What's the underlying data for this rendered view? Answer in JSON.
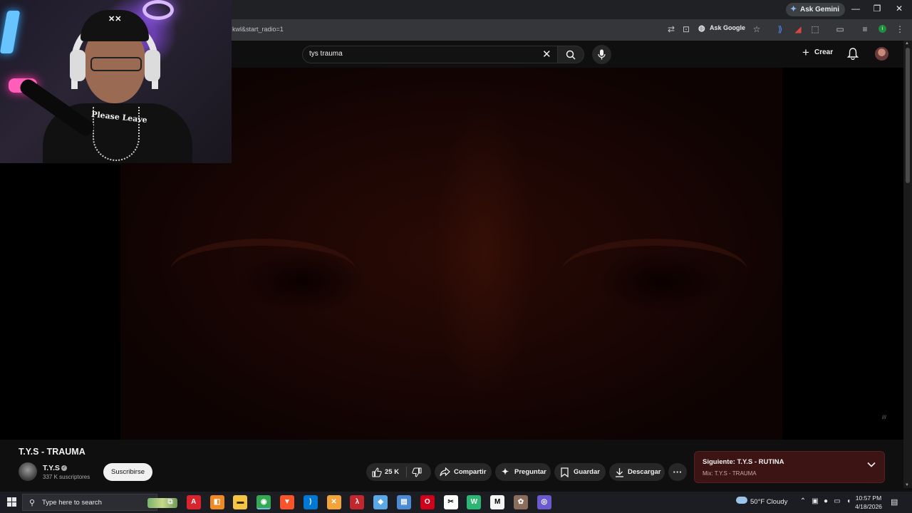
{
  "browser": {
    "gemini_label": "Ask Gemini",
    "url_fragment": "kwl&start_radio=1",
    "ask_google_label": "Ask Google",
    "profile_initial": "i",
    "window": {
      "minimize": "—",
      "restore": "❐",
      "close": "✕"
    }
  },
  "youtube": {
    "search": {
      "value": "tys trauma"
    },
    "create_label": "Crear"
  },
  "video": {
    "title": "T.Y.S - TRAUMA",
    "watermark": "///",
    "channel": {
      "name": "T.Y.S",
      "subscribers": "337 K suscriptores",
      "subscribe_label": "Suscribirse"
    },
    "actions": {
      "likes": "25 K",
      "share": "Compartir",
      "ask": "Preguntar",
      "save": "Guardar",
      "download": "Descargar",
      "more": "···"
    },
    "up_next": {
      "label": "Siguiente: T.Y.S - RUTINA",
      "mix": "Mix: T.Y.S - TRAUMA"
    }
  },
  "webcam": {
    "shirt_text": "Please Leave"
  },
  "taskbar": {
    "search_placeholder": "Type here to search",
    "weather": "50°F  Cloudy",
    "time": "10:57 PM",
    "date": "4/18/2026",
    "apps": [
      {
        "name": "task-view",
        "glyph": "⧉",
        "color": "#e8e8e8",
        "bg": "transparent"
      },
      {
        "name": "acrobat",
        "glyph": "A",
        "color": "#ffffff",
        "bg": "#d9232d"
      },
      {
        "name": "app-orange",
        "glyph": "◧",
        "color": "#ffffff",
        "bg": "#f08a24"
      },
      {
        "name": "file-explorer",
        "glyph": "▬",
        "color": "#3a2a00",
        "bg": "#f4c542"
      },
      {
        "name": "chrome",
        "glyph": "◉",
        "color": "#ffffff",
        "bg": "#34a853"
      },
      {
        "name": "brave",
        "glyph": "▼",
        "color": "#ffffff",
        "bg": "#fb542b"
      },
      {
        "name": "vscode",
        "glyph": "⟩",
        "color": "#ffffff",
        "bg": "#0078d4"
      },
      {
        "name": "app-x",
        "glyph": "✕",
        "color": "#ffffff",
        "bg": "#f2a33a"
      },
      {
        "name": "app-red-a",
        "glyph": "λ",
        "color": "#ffffff",
        "bg": "#c1272d"
      },
      {
        "name": "app-blue",
        "glyph": "◆",
        "color": "#ffffff",
        "bg": "#5aa9e6"
      },
      {
        "name": "notepad",
        "glyph": "▤",
        "color": "#ffffff",
        "bg": "#4b8bd4"
      },
      {
        "name": "opera",
        "glyph": "O",
        "color": "#ffffff",
        "bg": "#d0021b"
      },
      {
        "name": "capcut",
        "glyph": "✂",
        "color": "#000000",
        "bg": "#ffffff"
      },
      {
        "name": "app-wa",
        "glyph": "W",
        "color": "#ffffff",
        "bg": "#2bb673"
      },
      {
        "name": "app-m",
        "glyph": "M",
        "color": "#000000",
        "bg": "#f5f5f5"
      },
      {
        "name": "app-gear",
        "glyph": "✿",
        "color": "#ffffff",
        "bg": "#8a6d5b"
      },
      {
        "name": "app-circle",
        "glyph": "◎",
        "color": "#ffffff",
        "bg": "#6a5acd"
      }
    ]
  }
}
